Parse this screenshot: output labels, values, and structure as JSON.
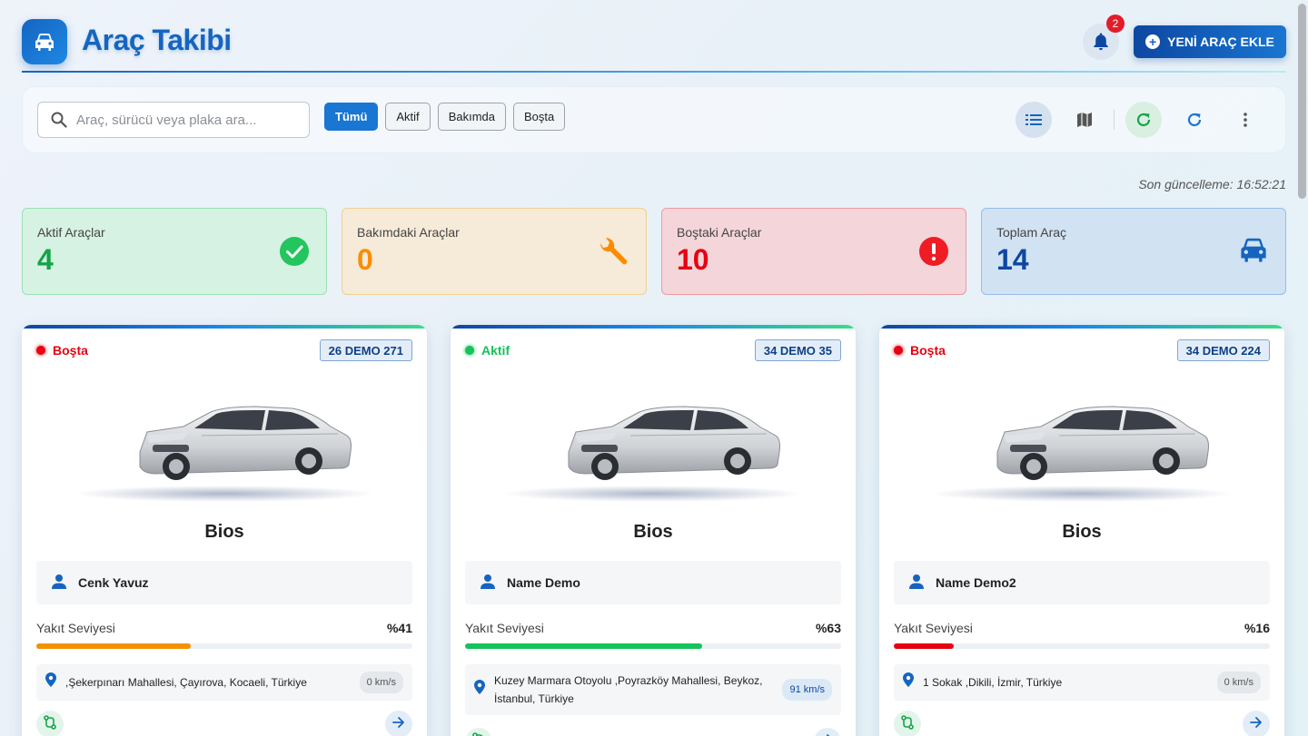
{
  "header": {
    "title": "Araç Takibi",
    "notifications_count": "2",
    "add_button_label": "YENİ ARAÇ EKLE"
  },
  "toolbar": {
    "search_placeholder": "Araç, sürücü veya plaka ara...",
    "filters": [
      "Tümü",
      "Aktif",
      "Bakımda",
      "Boşta"
    ],
    "active_filter": "Tümü",
    "view_icons": [
      "list-view-icon",
      "map-view-icon",
      "refresh-icon",
      "sync-icon",
      "more-vert-icon"
    ]
  },
  "last_update": "Son güncelleme: 16:52:21",
  "stats": [
    {
      "label": "Aktif Araçlar",
      "value": "4",
      "icon": "check-circle-icon",
      "color": "#16a34a"
    },
    {
      "label": "Bakımdaki Araçlar",
      "value": "0",
      "icon": "wrench-icon",
      "color": "#fb8c00"
    },
    {
      "label": "Boştaki Araçlar",
      "value": "10",
      "icon": "alert-circle-icon",
      "color": "#e60012"
    },
    {
      "label": "Toplam Araç",
      "value": "14",
      "icon": "car-icon",
      "color": "#1565c0"
    }
  ],
  "vehicles": [
    {
      "status": "Boşta",
      "status_color": "#e60012",
      "plate": "26 DEMO 271",
      "name": "Bios",
      "driver": "Cenk Yavuz",
      "fuel_label": "Yakıt Seviyesi",
      "fuel_text": "%41",
      "fuel_percent": 41,
      "fuel_color": "#f39200",
      "address": ",Şekerpınarı Mahallesi, Çayırova, Kocaeli, Türkiye",
      "speed": "0 km/s"
    },
    {
      "status": "Aktif",
      "status_color": "#16c25a",
      "plate": "34 DEMO 35",
      "name": "Bios",
      "driver": "Name Demo",
      "fuel_label": "Yakıt Seviyesi",
      "fuel_text": "%63",
      "fuel_percent": 63,
      "fuel_color": "#16c25a",
      "address": "Kuzey Marmara Otoyolu ,Poyrazköy Mahallesi, Beykoz, İstanbul, Türkiye",
      "speed": "91 km/s"
    },
    {
      "status": "Boşta",
      "status_color": "#e60012",
      "plate": "34 DEMO 224",
      "name": "Bios",
      "driver": "Name Demo2",
      "fuel_label": "Yakıt Seviyesi",
      "fuel_text": "%16",
      "fuel_percent": 16,
      "fuel_color": "#e60012",
      "address": "1 Sokak ,Dikili, İzmir, Türkiye",
      "speed": "0 km/s"
    }
  ]
}
